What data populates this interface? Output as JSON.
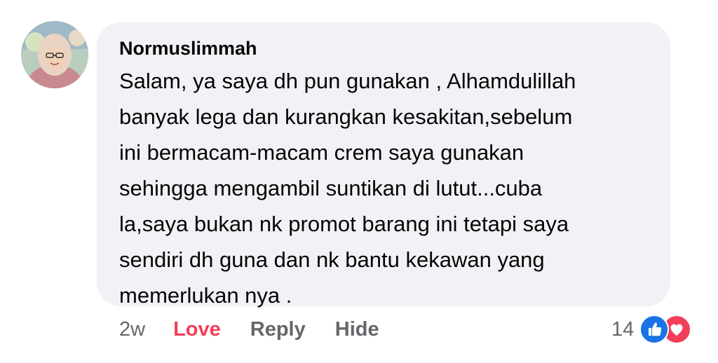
{
  "comment": {
    "author": "Normuslimmah",
    "text_lines": [
      "Salam, ya saya dh pun gunakan , Alhamdulillah",
      "banyak lega dan kurangkan kesakitan,sebelum",
      "ini bermacam-macam crem saya gunakan",
      "sehingga mengambil suntikan di lutut...cuba",
      "la,saya bukan nk promot barang ini tetapi saya",
      "sendiri dh guna dan nk bantu kekawan yang",
      "memerlukan nya ."
    ]
  },
  "actions": {
    "time": "2w",
    "love_label": "Love",
    "reply_label": "Reply",
    "hide_label": "Hide"
  },
  "reactions": {
    "count": "14",
    "icons": [
      "like-icon",
      "heart-icon"
    ]
  },
  "colors": {
    "bubble_bg": "#f0f2f5",
    "love": "#f33e58",
    "like": "#1b74e4",
    "muted": "#65676b"
  }
}
